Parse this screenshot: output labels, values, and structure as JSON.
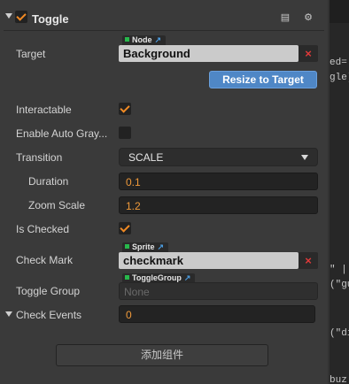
{
  "component": {
    "title": "Toggle",
    "enabled": true,
    "icons": [
      "book-icon",
      "gear-icon"
    ]
  },
  "target": {
    "label": "Target",
    "type_tag": "Node",
    "value": "Background",
    "resize_button": "Resize to Target"
  },
  "interactable": {
    "label": "Interactable",
    "checked": true
  },
  "auto_gray": {
    "label": "Enable Auto Gray...",
    "checked": false
  },
  "transition": {
    "label": "Transition",
    "value": "SCALE"
  },
  "duration": {
    "label": "Duration",
    "value": "0.1"
  },
  "zoom_scale": {
    "label": "Zoom Scale",
    "value": "1.2"
  },
  "is_checked": {
    "label": "Is Checked",
    "checked": true
  },
  "check_mark": {
    "label": "Check Mark",
    "type_tag": "Sprite",
    "value": "checkmark"
  },
  "toggle_group": {
    "label": "Toggle Group",
    "type_tag": "ToggleGroup",
    "value": "None"
  },
  "check_events": {
    "label": "Check Events",
    "value": "0"
  },
  "add_component": {
    "label": "添加组件"
  },
  "code_fragments": [
    "ed=",
    "gle)",
    "\" |",
    "(\"gu",
    "(\"di",
    "buz"
  ],
  "colors": {
    "accent": "#f08a24",
    "button_blue": "#4f87c6",
    "remove_red": "#e03a3a"
  }
}
